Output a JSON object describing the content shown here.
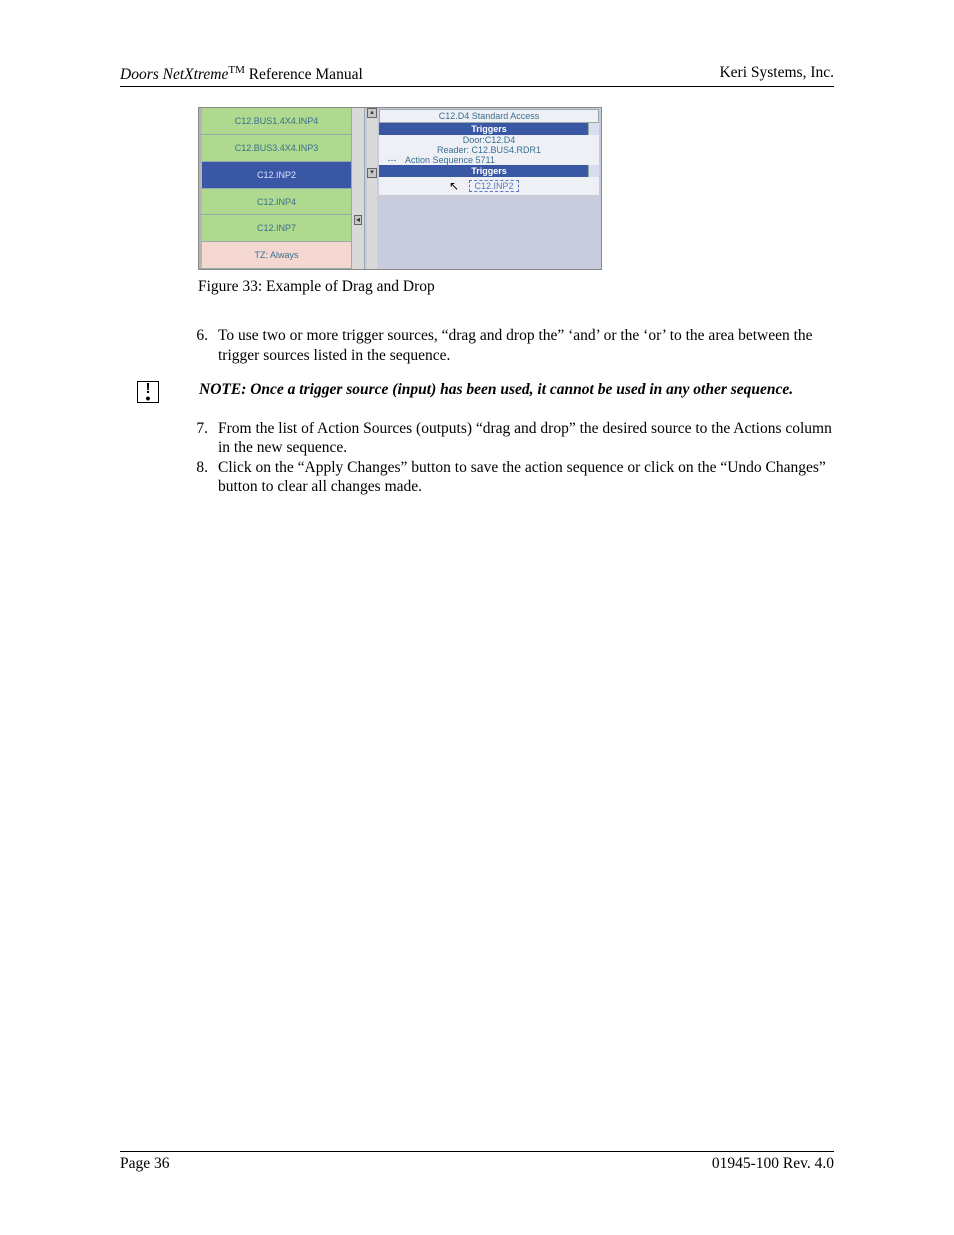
{
  "header": {
    "product": "Doors NetXtreme",
    "tm": "TM",
    "suffix": " Reference Manual",
    "company": "Keri Systems, Inc."
  },
  "screenshot": {
    "left_items": [
      {
        "label": "C12.BUS1.4X4.INP4",
        "cls": "cgreen"
      },
      {
        "label": "C12.BUS3.4X4.INP3",
        "cls": "cgreen"
      },
      {
        "label": "C12.INP2",
        "cls": "cblue"
      },
      {
        "label": "C12.INP4",
        "cls": "cgreen"
      },
      {
        "label": "C12.INP7",
        "cls": "cgreen"
      },
      {
        "label": "TZ: Always",
        "cls": "cpink"
      }
    ],
    "right": {
      "title": "C12.D4 Standard Access",
      "triggers_label": "Triggers",
      "door_line1": "Door:C12.D4",
      "door_line2": "Reader: C12.BUS4.RDR1",
      "seq_label": "Action Sequence 5711",
      "triggers_label2": "Triggers",
      "drag_label": "C12.INP2"
    }
  },
  "caption": "Figure 33: Example of Drag and Drop",
  "steps_a": [
    {
      "n": "6.",
      "t": "To use two or more trigger sources, “drag and drop the” ‘and’ or the ‘or’ to the area between the trigger sources listed in the sequence."
    }
  ],
  "note": "NOTE: Once a trigger source (input) has been used, it cannot be used in any other sequence.",
  "steps_b": [
    {
      "n": "7.",
      "t": "From the list of Action Sources (outputs) “drag and drop” the desired source to the Actions column in the new sequence."
    },
    {
      "n": "8.",
      "t": "Click on the “Apply Changes” button to save the action sequence or click on the “Undo Changes” button to clear all changes made."
    }
  ],
  "footer": {
    "page": "Page 36",
    "rev": "01945-100  Rev. 4.0"
  }
}
